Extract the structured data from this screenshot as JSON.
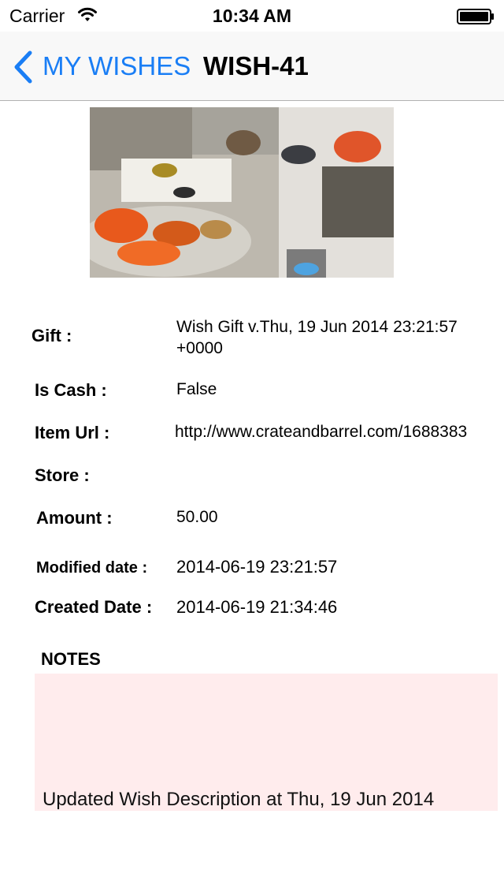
{
  "status_bar": {
    "carrier": "Carrier",
    "time": "10:34 AM"
  },
  "nav": {
    "back_label": "MY WISHES",
    "title": "WISH-41",
    "accent_color": "#1a7ef5"
  },
  "details": {
    "gift_label": "Gift :",
    "gift_value": "Wish Gift v.Thu, 19 Jun 2014 23:21:57 +0000",
    "is_cash_label": "Is Cash :",
    "is_cash_value": "False",
    "item_url_label": "Item Url :",
    "item_url_value": "http://www.crateandbarrel.com/1688383",
    "store_label": "Store :",
    "amount_label": "Amount :",
    "amount_value": "50.00",
    "modified_label": "Modified date :",
    "modified_value": "2014-06-19 23:21:57",
    "created_label": "Created Date :",
    "created_value": "2014-06-19 21:34:46"
  },
  "notes": {
    "heading": "NOTES",
    "text": "Updated Wish Description at Thu, 19 Jun 2014",
    "background_color": "#ffeced"
  },
  "icons": [
    "wifi-icon",
    "battery-icon",
    "chevron-left-icon"
  ]
}
